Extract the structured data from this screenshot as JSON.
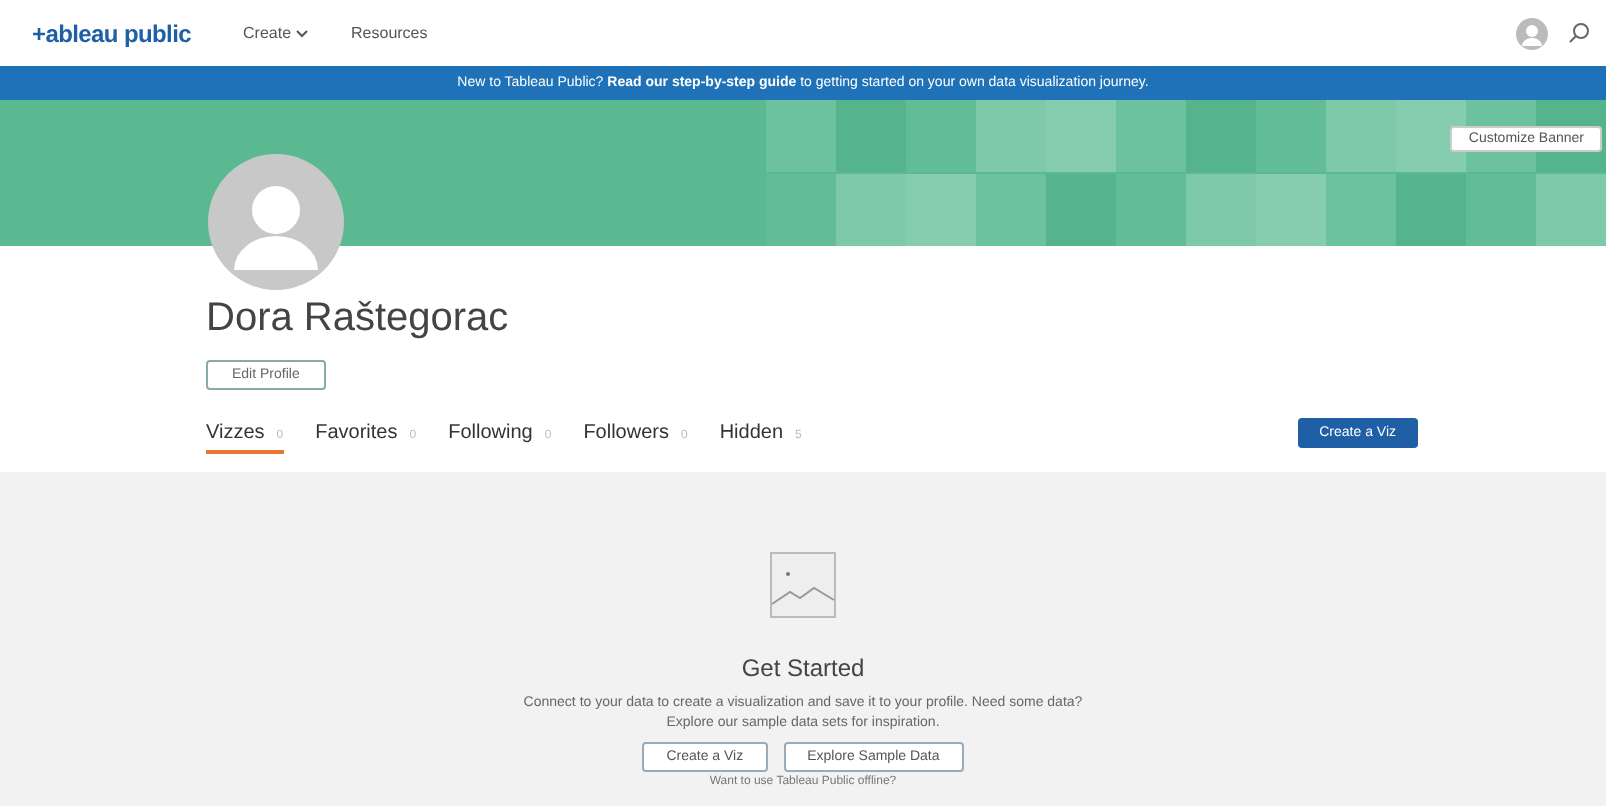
{
  "header": {
    "logo": "+ableau public",
    "nav": [
      {
        "label": "Create",
        "dropdown": true
      },
      {
        "label": "Resources",
        "dropdown": false
      }
    ]
  },
  "announcement": {
    "text": "New to Tableau Public? **Read our step-by-step guide** to getting started on your own data visualization journey."
  },
  "banner": {
    "button": "Customize Banner"
  },
  "profile": {
    "name": "Dora Raštegorac",
    "edit_button": "Edit Profile"
  },
  "tabs": [
    {
      "label": "Vizzes",
      "count": "0",
      "selected": true
    },
    {
      "label": "Favorites",
      "count": "0",
      "selected": false
    },
    {
      "label": "Following",
      "count": "0",
      "selected": false
    },
    {
      "label": "Followers",
      "count": "0",
      "selected": false
    },
    {
      "label": "Hidden",
      "count": "5",
      "selected": false
    }
  ],
  "create_button": "Create a Viz",
  "empty_state": {
    "title": "Get Started",
    "lines": [
      "Connect to your data to create a visualization and save it to your profile. Need some data?",
      "Explore our sample data sets for inspiration."
    ],
    "buttons": [
      "Create a Viz",
      "Explore Sample Data"
    ],
    "footer": "Want to use Tableau Public offline?"
  }
}
